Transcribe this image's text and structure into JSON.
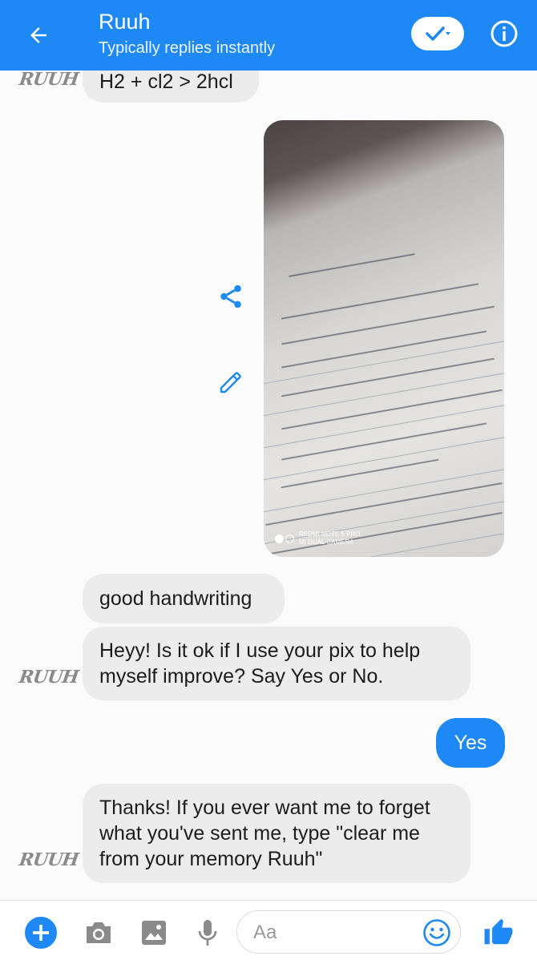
{
  "header": {
    "title": "Ruuh",
    "subtitle": "Typically replies instantly"
  },
  "avatar_text": "RUUH",
  "messages": [
    {
      "text": "H2 + cl2 > 2hcl"
    },
    {
      "text": "good handwriting"
    },
    {
      "text": "Heyy! Is it ok if I use your pix to help myself improve? Say Yes or No."
    },
    {
      "text": "Yes"
    },
    {
      "text": "Thanks! If you ever want me to forget what you've sent me, type \"clear me from your memory Ruuh\""
    }
  ],
  "photo": {
    "watermark_line1": "REDMI NOTE 5 PRO",
    "watermark_line2": "MI DUAL CAMERA"
  },
  "composer": {
    "placeholder": "Aa"
  },
  "colors": {
    "accent": "#1e88f5",
    "bubble_gray": "#ececec"
  },
  "icons": [
    "back-arrow-icon",
    "check-icon",
    "info-icon",
    "share-icon",
    "edit-icon",
    "plus-icon",
    "camera-icon",
    "gallery-icon",
    "microphone-icon",
    "emoji-icon",
    "thumbs-up-icon"
  ]
}
